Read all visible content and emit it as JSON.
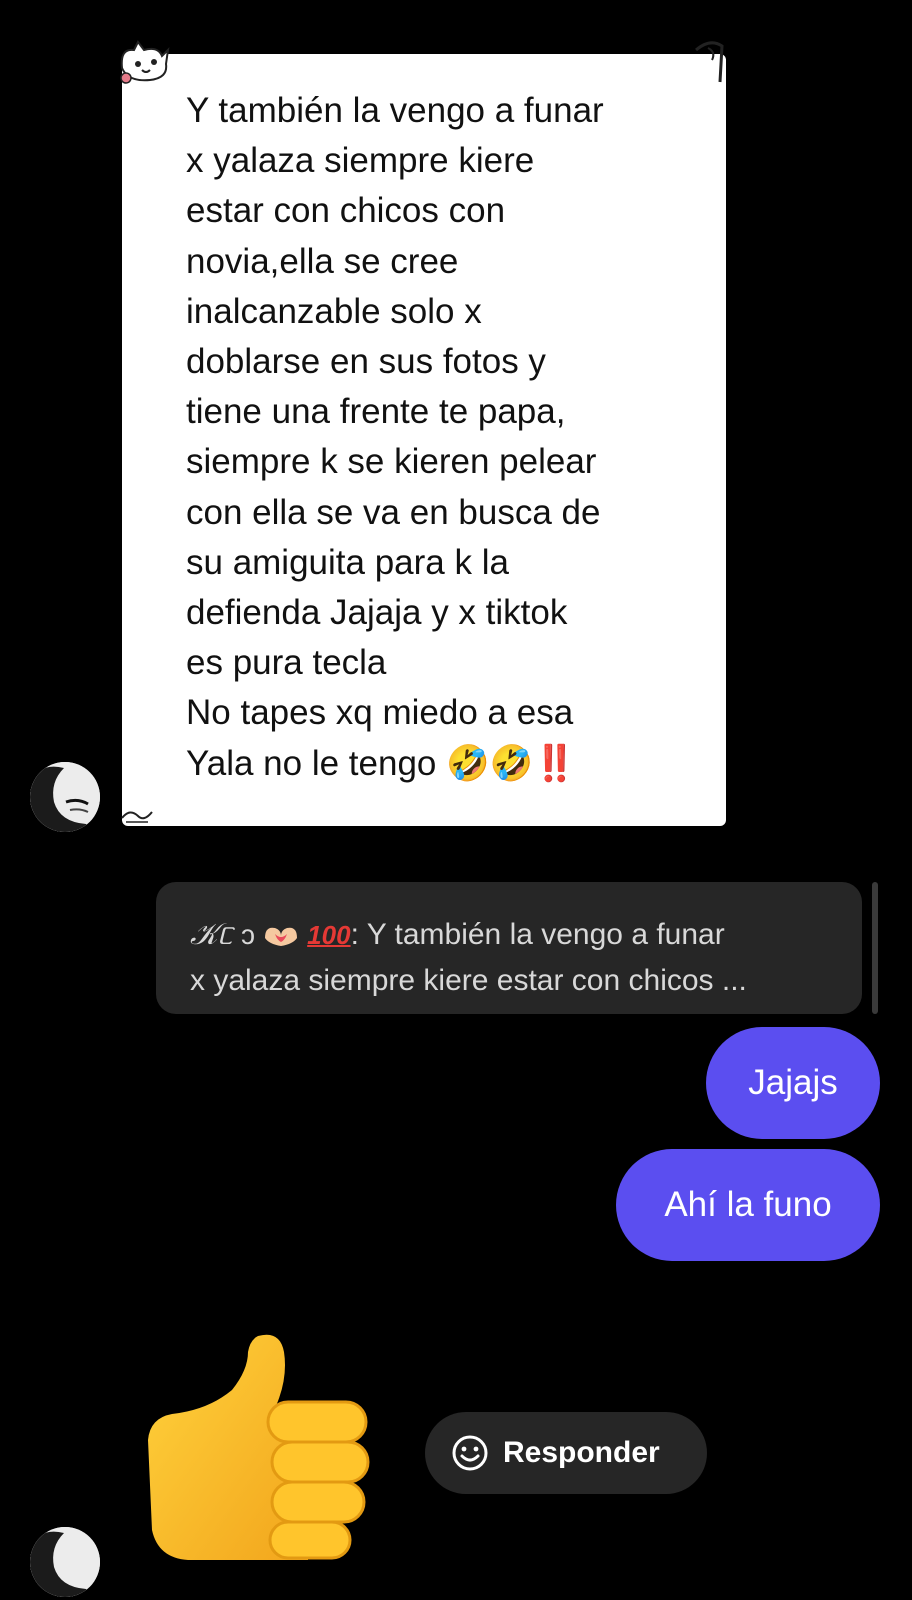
{
  "incoming": {
    "text": "Y también la vengo a funar\nx yalaza siempre kiere\nestar con chicos con\nnovia,ella se cree\ninalcanzable solo x\ndoblarse en sus fotos y\ntiene una frente te papa,\nsiempre k se kieren pelear\ncon ella se va en busca de\nsu amiguita para k la\ndefienda Jajaja y x tiktok\nes pura tecla\nNo tapes xq miedo a esa\nYala no le tengo 🤣🤣‼️"
  },
  "reply_preview": {
    "author": "𝒦ᥴ",
    "hundred": "100",
    "colon": ":",
    "line1": " Y también la vengo a funar",
    "line2": "x yalaza siempre kiere estar con chicos ..."
  },
  "outgoing": [
    {
      "text": "Jajajs"
    },
    {
      "text": "Ahí la funo"
    }
  ],
  "reaction_emoji": "thumbs-up",
  "respond_button": {
    "label": "Responder"
  },
  "colors": {
    "background": "#000000",
    "outgoing_bubble": "#5b4ef0",
    "reply_preview_bg": "#262626",
    "incoming_bubble": "#ffffff"
  }
}
